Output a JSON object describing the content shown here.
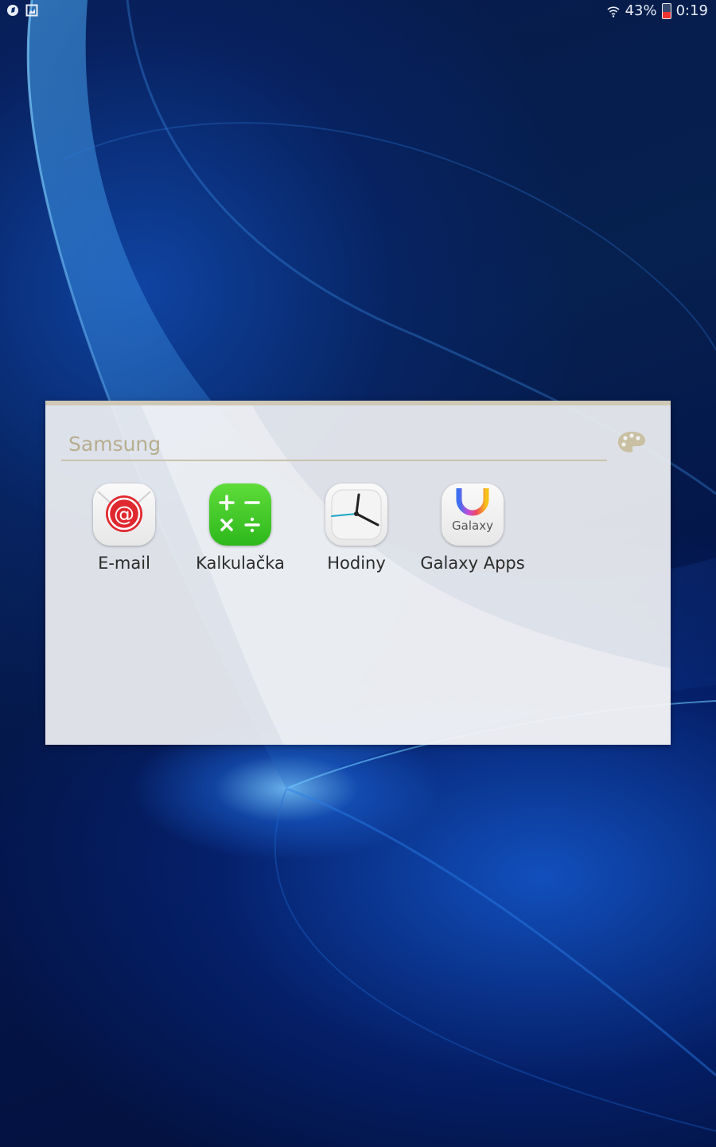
{
  "status_bar": {
    "left_icons": [
      "notification-icon",
      "screenshot-icon"
    ],
    "wifi_icon": "wifi-icon",
    "battery_percent": "43%",
    "battery_icon": "battery-low-icon",
    "time": "0:19"
  },
  "folder": {
    "name": "Samsung",
    "palette_icon": "palette-icon",
    "apps": [
      {
        "label": "E-mail",
        "icon": "email-icon"
      },
      {
        "label": "Kalkulačka",
        "icon": "calculator-icon"
      },
      {
        "label": "Hodiny",
        "icon": "clock-icon"
      },
      {
        "label": "Galaxy Apps",
        "icon": "galaxy-apps-icon",
        "icon_text": "Galaxy"
      }
    ]
  },
  "colors": {
    "folder_accent": "#cfc8b6",
    "title_text": "#b7ae90",
    "email_red": "#e0292f",
    "calculator_green": "#3cc424"
  }
}
